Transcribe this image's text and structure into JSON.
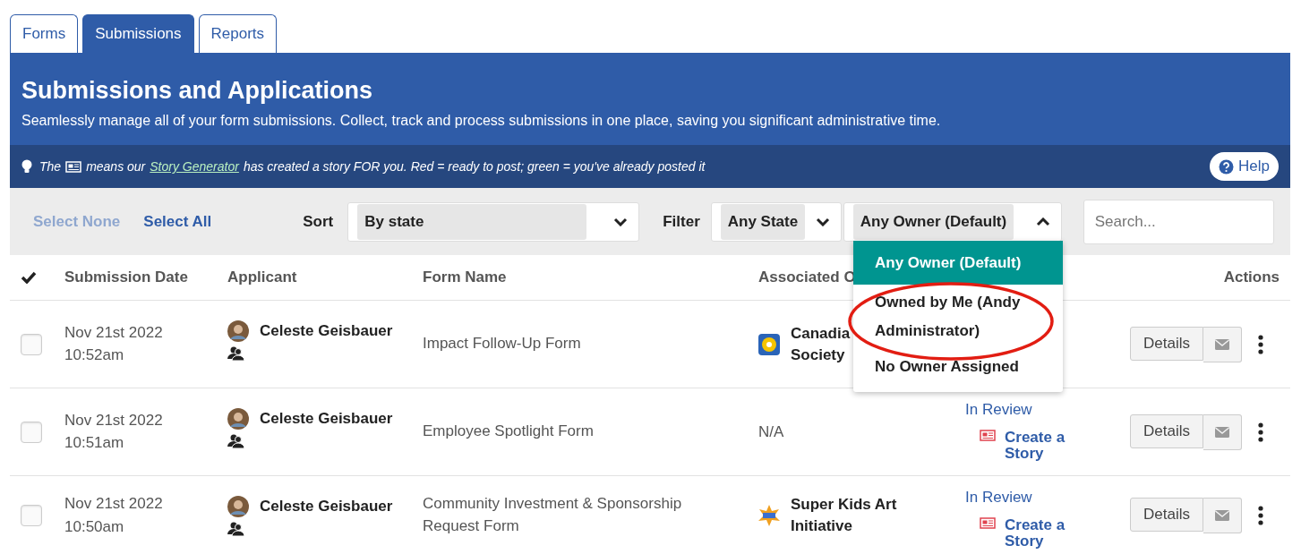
{
  "tabs": [
    {
      "label": "Forms",
      "selected": false
    },
    {
      "label": "Submissions",
      "selected": true
    },
    {
      "label": "Reports",
      "selected": false
    }
  ],
  "header": {
    "title": "Submissions and Applications",
    "subtitle": "Seamlessly manage all of your form submissions. Collect, track and process submissions in one place, saving you significant administrative time."
  },
  "notice": {
    "before": "The",
    "middle": "means our",
    "link": "Story Generator",
    "after": "has created a story FOR you. Red = ready to post; green = you've already posted it",
    "help": "Help"
  },
  "toolbar": {
    "select_none": {
      "label": "Select None",
      "disabled": true
    },
    "select_all": {
      "label": "Select All",
      "disabled": false
    },
    "sort_label": "Sort",
    "sort_value": "By state",
    "filter_label": "Filter",
    "state_value": "Any State",
    "owner_value": "Any Owner (Default)",
    "owner_expanded": true,
    "search_placeholder": "Search..."
  },
  "owner_options": [
    {
      "label": "Any Owner (Default)",
      "selected": true
    },
    {
      "label": "Owned by Me  (Andy Administrator)",
      "selected": false
    },
    {
      "label": "No Owner Assigned",
      "selected": false
    }
  ],
  "table": {
    "columns": [
      "Submission Date",
      "Applicant",
      "Form Name",
      "Associated O",
      "Actions"
    ],
    "rows": [
      {
        "checked": false,
        "date": "Nov 21st 2022",
        "time": "10:52am",
        "applicant": "Celeste Geisbauer",
        "form": "Impact Follow-Up Form",
        "org": {
          "kind": "logo",
          "lines": [
            "Canadia",
            "Society"
          ]
        },
        "details": "Details"
      },
      {
        "checked": false,
        "date": "Nov 21st 2022",
        "time": "10:51am",
        "applicant": "Celeste Geisbauer",
        "form": "Employee Spotlight Form",
        "org": {
          "kind": "plain",
          "lines": [
            "N/A"
          ]
        },
        "status": {
          "state": "In Review",
          "story": "Create a Story"
        },
        "details": "Details"
      },
      {
        "checked": false,
        "date": "Nov 21st 2022",
        "time": "10:50am",
        "applicant": "Celeste Geisbauer",
        "form": "Community Investment & Sponsorship Request Form",
        "org": {
          "kind": "logo",
          "lines": [
            "Super Kids Art",
            "Initiative"
          ]
        },
        "status": {
          "state": "In Review",
          "story": "Create a Story"
        },
        "details": "Details"
      }
    ]
  }
}
